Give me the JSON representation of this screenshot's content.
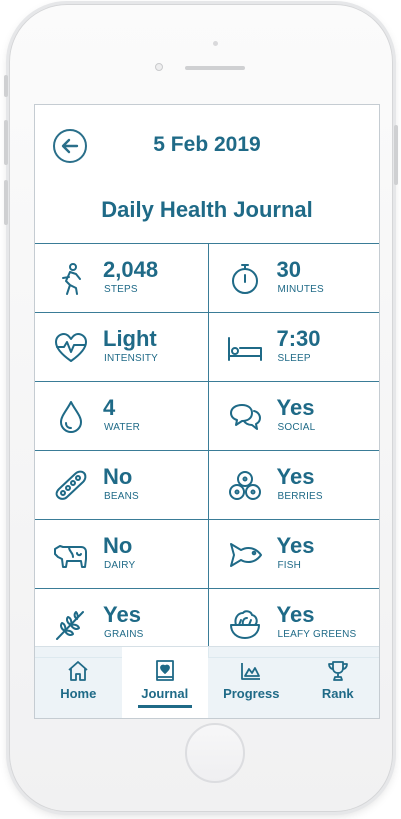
{
  "header": {
    "date": "5 Feb 2019",
    "title": "Daily Health Journal"
  },
  "metrics": [
    {
      "value": "2,048",
      "label": "STEPS",
      "icon": "walking-person-icon"
    },
    {
      "value": "30",
      "label": "MINUTES",
      "icon": "stopwatch-icon"
    },
    {
      "value": "Light",
      "label": "INTENSITY",
      "icon": "heartbeat-icon"
    },
    {
      "value": "7:30",
      "label": "SLEEP",
      "icon": "bed-icon"
    },
    {
      "value": "4",
      "label": "WATER",
      "icon": "water-drop-icon"
    },
    {
      "value": "Yes",
      "label": "SOCIAL",
      "icon": "chat-bubbles-icon"
    },
    {
      "value": "No",
      "label": "BEANS",
      "icon": "bean-pod-icon"
    },
    {
      "value": "Yes",
      "label": "BERRIES",
      "icon": "berries-icon"
    },
    {
      "value": "No",
      "label": "DAIRY",
      "icon": "cow-icon"
    },
    {
      "value": "Yes",
      "label": "FISH",
      "icon": "fish-icon"
    },
    {
      "value": "Yes",
      "label": "GRAINS",
      "icon": "wheat-icon"
    },
    {
      "value": "Yes",
      "label": "LEAFY GREENS",
      "icon": "leafy-greens-bowl-icon"
    }
  ],
  "nav": {
    "items": [
      {
        "label": "Home",
        "icon": "house-icon"
      },
      {
        "label": "Journal",
        "icon": "journal-book-icon",
        "active": true
      },
      {
        "label": "Progress",
        "icon": "area-chart-icon"
      },
      {
        "label": "Rank",
        "icon": "trophy-icon"
      }
    ]
  },
  "colors": {
    "primary": "#1f6a87",
    "grid_line": "#3a7c97",
    "nav_background": "#ecf2f6"
  }
}
